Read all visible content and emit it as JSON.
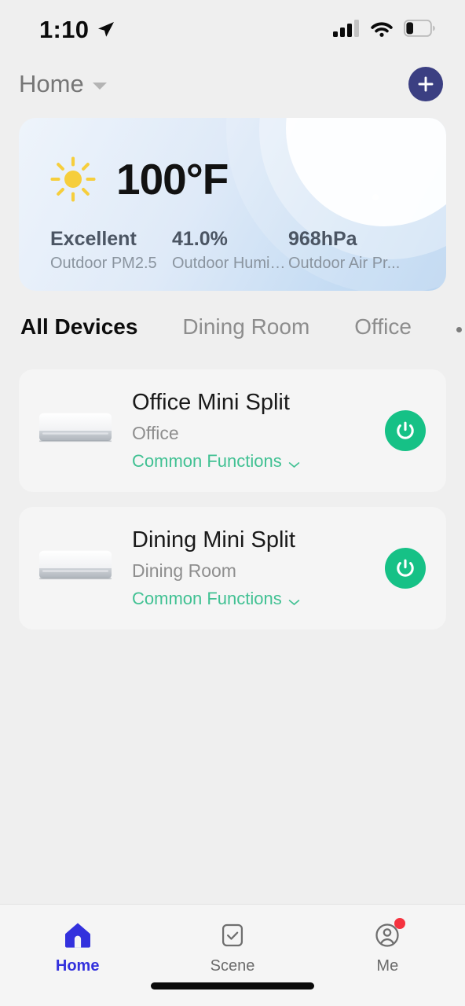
{
  "status_bar": {
    "time": "1:10",
    "location_icon": "location-arrow-icon",
    "signal_icon": "cellular-signal-icon",
    "signal_bars_filled": 3,
    "signal_bars_total": 4,
    "wifi_icon": "wifi-icon",
    "battery_icon": "battery-low-icon",
    "battery_level_percent": 25
  },
  "header": {
    "home_label": "Home",
    "dropdown_icon": "chevron-down-icon",
    "add_button_icon": "plus-icon",
    "add_button_color": "#3b3f82"
  },
  "weather": {
    "condition_icon": "sun-icon",
    "temperature": "100°F",
    "stats": [
      {
        "value": "Excellent",
        "label": "Outdoor PM2.5"
      },
      {
        "value": "41.0%",
        "label": "Outdoor Humid..."
      },
      {
        "value": "968hPa",
        "label": "Outdoor Air Pr..."
      }
    ]
  },
  "tabs": {
    "items": [
      {
        "label": "All Devices",
        "active": true
      },
      {
        "label": "Dining Room",
        "active": false
      },
      {
        "label": "Office",
        "active": false
      }
    ],
    "more_icon": "ellipsis-icon"
  },
  "devices": [
    {
      "thumbnail_icon": "mini-split-ac-icon",
      "name": "Office Mini Split",
      "room": "Office",
      "functions_label": "Common Functions",
      "functions_icon": "chevron-down-icon",
      "power_icon": "power-icon",
      "power_color": "#16c186"
    },
    {
      "thumbnail_icon": "mini-split-ac-icon",
      "name": "Dining Mini Split",
      "room": "Dining Room",
      "functions_label": "Common Functions",
      "functions_icon": "chevron-down-icon",
      "power_icon": "power-icon",
      "power_color": "#16c186"
    }
  ],
  "bottom_nav": {
    "items": [
      {
        "label": "Home",
        "icon": "house-icon",
        "active": true,
        "badge": false
      },
      {
        "label": "Scene",
        "icon": "checkbox-square-icon",
        "active": false,
        "badge": false
      },
      {
        "label": "Me",
        "icon": "user-circle-icon",
        "active": false,
        "badge": true
      }
    ],
    "active_color": "#3331dd"
  },
  "theme": {
    "page_background": "#efefef",
    "card_background": "#f5f5f5",
    "accent_green": "#16c186",
    "accent_teal_text": "#41c193",
    "badge_red": "#f5333f"
  }
}
